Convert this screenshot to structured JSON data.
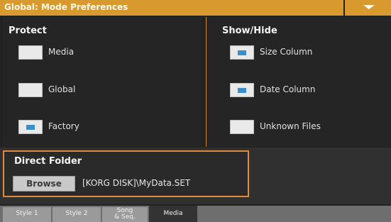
{
  "window": {
    "title": "Global: Mode Preferences"
  },
  "protect": {
    "title": "Protect",
    "items": [
      {
        "label": "Media",
        "checked": false
      },
      {
        "label": "Global",
        "checked": false
      },
      {
        "label": "Factory",
        "checked": true
      }
    ]
  },
  "show_hide": {
    "title": "Show/Hide",
    "items": [
      {
        "label": "Size Column",
        "checked": true
      },
      {
        "label": "Date Column",
        "checked": true
      },
      {
        "label": "Unknown Files",
        "checked": false
      }
    ]
  },
  "direct_folder": {
    "title": "Direct Folder",
    "browse_label": "Browse",
    "path": "[KORG DISK]\\MyData.SET"
  },
  "tabs": [
    {
      "line1": "Style 1",
      "line2": ""
    },
    {
      "line1": "Style 2",
      "line2": ""
    },
    {
      "line1": "Song",
      "line2": "& Seq."
    },
    {
      "line1": "Media",
      "line2": ""
    }
  ],
  "colors": {
    "accent": "#d89a2e",
    "highlight_border": "#e08a3a",
    "checkbox_mark": "#3a8ec9"
  },
  "icons": {
    "menu": "chevron-down-icon"
  }
}
